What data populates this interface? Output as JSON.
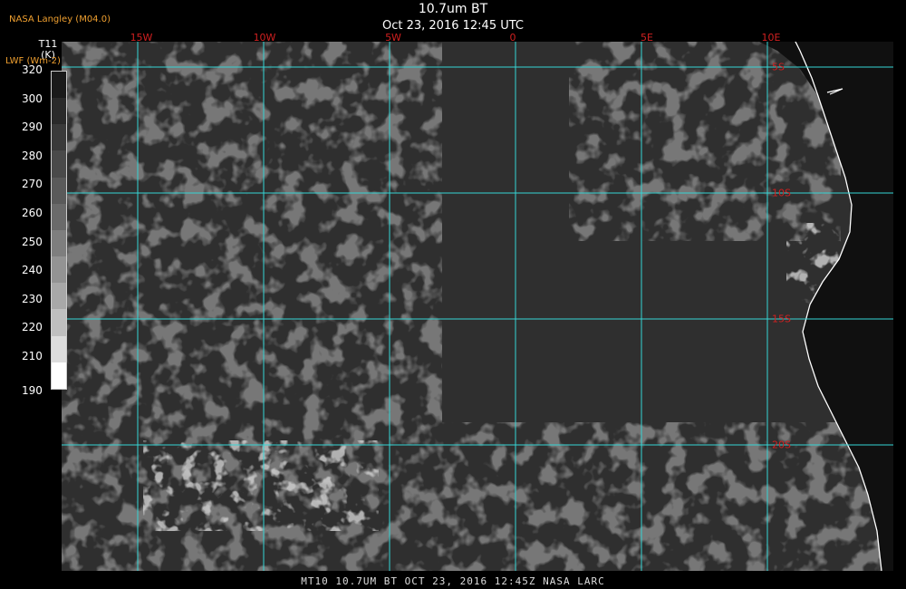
{
  "header": {
    "title": "10.7um BT",
    "subtitle": "Oct 23, 2016 12:45 UTC"
  },
  "source": "NASA Langley (M04.0)",
  "scale": {
    "variable": "T11",
    "unit": "(K)",
    "alt_variable": "LWF (Wm-2)",
    "ticks": [
      "320",
      "300",
      "290",
      "280",
      "270",
      "260",
      "250",
      "240",
      "230",
      "220",
      "210",
      "190"
    ],
    "colors": [
      "#1a1a1a",
      "#2a2a2a",
      "#3a3a3a",
      "#4a4a4a",
      "#5a5a5a",
      "#6a6a6a",
      "#7e7e7e",
      "#939393",
      "#a8a8a8",
      "#bfbfbf",
      "#dcdcdc",
      "#ffffff"
    ]
  },
  "map": {
    "lon_labels": [
      "15W",
      "10W",
      "5W",
      "0",
      "5E",
      "10E"
    ],
    "lat_labels": [
      "5S",
      "10S",
      "15S",
      "20S"
    ],
    "grid_color": "#35d6d6",
    "label_color": "#d02020",
    "coast_color": "#ffffff"
  },
  "footer": "MT10   10.7UM BT   OCT 23, 2016 12:45Z   NASA LARC"
}
